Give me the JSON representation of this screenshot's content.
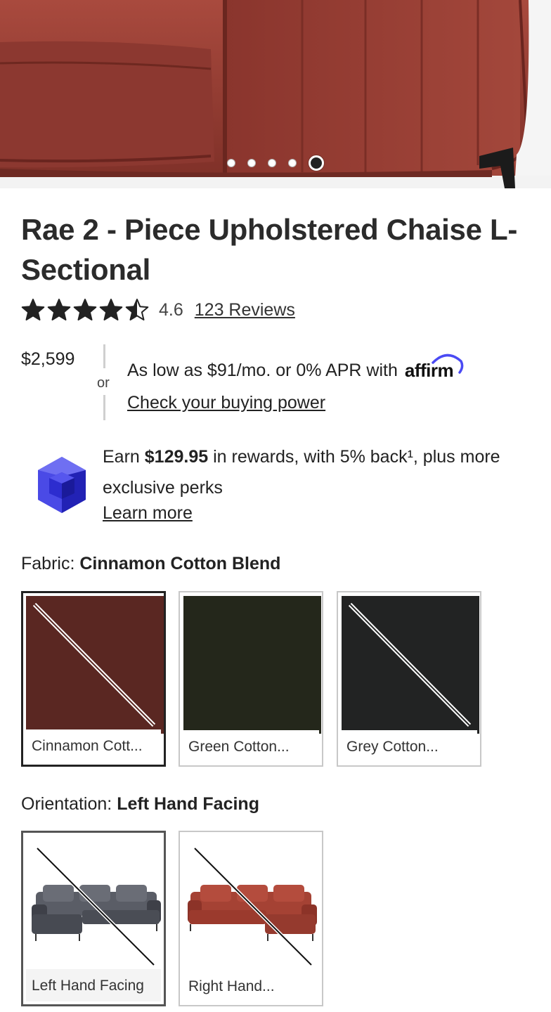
{
  "hero": {
    "image_name": "product-photo-sofa-closeup",
    "carousel": {
      "count": 5,
      "active_index": 4
    }
  },
  "product": {
    "title": "Rae 2 - Piece Upholstered Chaise L-Sectional",
    "rating": 4.6,
    "rating_text": "4.6",
    "reviews_label": "123 Reviews",
    "price": "$2,599"
  },
  "financing": {
    "or_label": "or",
    "text": "As low as $91/mo. or 0% APR with",
    "brand": "affirm",
    "link": "Check your buying power"
  },
  "rewards": {
    "prefix": "Earn ",
    "amount": "$129.95",
    "suffix": " in rewards, with 5% back¹, plus more exclusive perks",
    "link": "Learn more",
    "icon": "gem-icon"
  },
  "fabric": {
    "label": "Fabric: ",
    "selected": "Cinnamon Cotton Blend",
    "options": [
      {
        "caption": "Cinnamon Cott...",
        "color": "#5a2722",
        "unavailable": true,
        "selected": true
      },
      {
        "caption": "Green Cotton...",
        "color": "#24271b",
        "unavailable": false,
        "selected": false
      },
      {
        "caption": "Grey Cotton...",
        "color": "#222323",
        "unavailable": true,
        "selected": false
      }
    ]
  },
  "orientation": {
    "label": "Orientation: ",
    "selected": "Left Hand Facing",
    "options": [
      {
        "caption": "Left Hand Facing",
        "sofa_color": "#4a4d55",
        "unavailable": true,
        "selected": true
      },
      {
        "caption": "Right Hand...",
        "sofa_color": "#9b3a2d",
        "unavailable": true,
        "selected": false
      }
    ]
  }
}
